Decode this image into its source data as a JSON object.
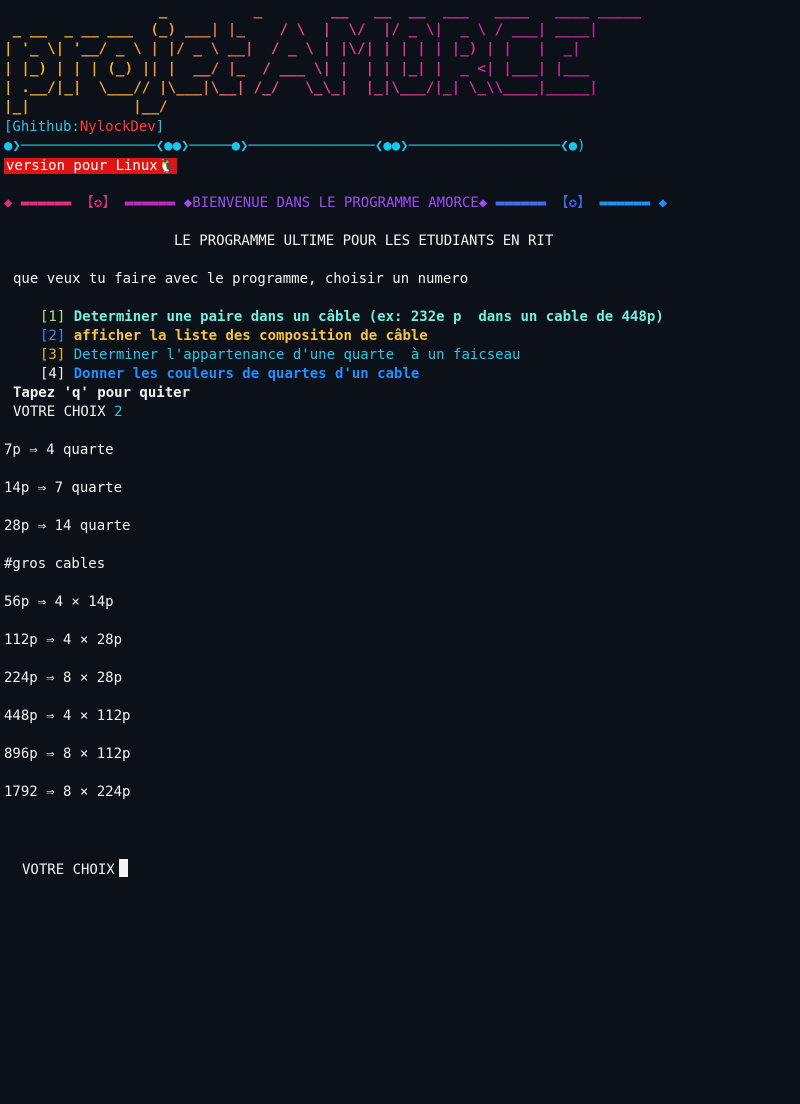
{
  "banner": {
    "ascii_lines": [
      "                  _          _        __   __  __  ___   ____   ____ _____",
      " _ __  _ __ ___  (_) ___| |_    / \\  |  \\/  |/ _ \\|  _ \\ / ___| ____|",
      "| '_ \\| '__/ _ \\ | |/ _ \\ __|  / _ \\ | |\\/| | | | | |_) | |   |  _|",
      "| |_) | | | (_) || |  __/ |_  / ___ \\| |  | | |_| |  _ <| |___| |___",
      "| .__/|_|  \\___// |\\___|\\__| /_/   \\_\\_|  |_|\\___/|_| \\_\\\\____|_____|",
      "|_|            |__/"
    ]
  },
  "github": {
    "open": "[Ghithub:",
    "user": "NylockDev",
    "close": "]"
  },
  "timeline": "●❯────────────────❮●●❯─────●❯───────────────❮●●❯──────────────────❮●)",
  "version_badge": "version pour Linux🐧",
  "welcome_line": {
    "left_diamond": "◆",
    "left_bar1": "▬▬▬▬▬▬",
    "left_mark": "【✪】",
    "left_bar2": "▬▬▬▬▬▬",
    "text": "◆BIENVENUE DANS LE PROGRAMME AMORCE◆",
    "right_bar1": "▬▬▬▬▬▬",
    "right_mark": "【✪】",
    "right_bar2": "▬▬▬▬▬▬",
    "right_diamond": "◆"
  },
  "subtitle": "LE PROGRAMME ULTIME POUR LES ETUDIANTS EN RIT",
  "prompt_question": "que veux tu faire avec le programme, choisir un numero",
  "menu": [
    {
      "num": "[1]",
      "label": "Determiner une paire dans un câble (ex: 232e p  dans un cable de 448p)"
    },
    {
      "num": "[2]",
      "label": "afficher la liste des composition de câble"
    },
    {
      "num": "[3]",
      "label": "Determiner l'appartenance d'une quarte  à un faicseau"
    },
    {
      "num": "[4]",
      "label": "Donner les couleurs de quartes d'un cable"
    }
  ],
  "quit_hint": "Tapez 'q' pour quiter",
  "choice": {
    "label": "VOTRE CHOIX",
    "value": "2"
  },
  "output": [
    "7p ⇒ 4 quarte",
    "14p ⇒ 7 quarte",
    "28p ⇒ 14 quarte",
    "#gros cables",
    "56p ⇒ 4 × 14p",
    "112p ⇒ 4 × 28p",
    "224p ⇒ 8 × 28p",
    "448p ⇒ 4 × 112p",
    "896p ⇒ 8 × 112p",
    "1792 ⇒ 8 × 224p"
  ],
  "final_prompt": "VOTRE CHOIX",
  "colors": {
    "background": "#0c1018",
    "cyan": "#29c7e3",
    "red_badge": "#e01414",
    "banner_start": "#f0b429",
    "banner_end": "#c0209c"
  }
}
